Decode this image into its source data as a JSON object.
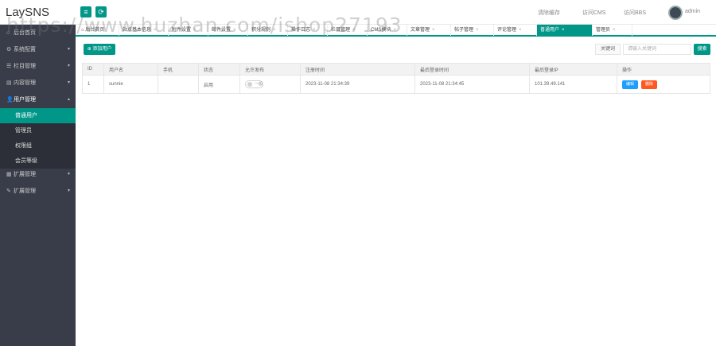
{
  "app": {
    "logo": "LaySNS"
  },
  "topbar": {
    "menu_icon": "≡",
    "refresh_icon": "⟳",
    "links": [
      "清除缓存",
      "访问CMS",
      "访问BBS"
    ],
    "user": "admin"
  },
  "sidebar": {
    "items": [
      {
        "icon": "⌂",
        "label": "后台首页"
      },
      {
        "icon": "⚙",
        "label": "系统配置",
        "arrow": "▾"
      },
      {
        "icon": "☰",
        "label": "栏目管理",
        "arrow": "▾"
      },
      {
        "icon": "▤",
        "label": "内容管理",
        "arrow": "▾"
      },
      {
        "icon": "👤",
        "label": "用户管理",
        "arrow": "▴"
      }
    ],
    "sub_items": [
      {
        "label": "普通用户",
        "active": true
      },
      {
        "label": "管理员"
      },
      {
        "label": "权限组"
      },
      {
        "label": "会员等级"
      }
    ],
    "bottom_items": [
      {
        "icon": "▦",
        "label": "扩展管理",
        "arrow": "▾"
      },
      {
        "icon": "✎",
        "label": "扩展管理",
        "arrow": "▾"
      }
    ]
  },
  "tabs": [
    {
      "label": "后台首页",
      "close": ""
    },
    {
      "label": "站点基本信息",
      "close": "×"
    },
    {
      "label": "附件设置",
      "close": "×"
    },
    {
      "label": "邮件设置",
      "close": "×"
    },
    {
      "label": "积分规则",
      "close": "×"
    },
    {
      "label": "操作日志",
      "close": "×"
    },
    {
      "label": "栏目管理",
      "close": "×"
    },
    {
      "label": "CMS模块",
      "close": "×"
    },
    {
      "label": "文章管理",
      "close": "×"
    },
    {
      "label": "帖子管理",
      "close": "×"
    },
    {
      "label": "评论管理",
      "close": "×"
    },
    {
      "label": "普通用户",
      "close": "×",
      "active": true
    },
    {
      "label": "管理员",
      "close": "×"
    }
  ],
  "toolbar": {
    "add_label": "⊕ 添加用户",
    "keyword_label": "关键词",
    "keyword_placeholder": "请输入关键词",
    "search_label": "搜索"
  },
  "table": {
    "columns": [
      "ID",
      "用户名",
      "手机",
      "状态",
      "允许发布",
      "注册时间",
      "最后登录时间",
      "最后登录IP",
      "操作"
    ],
    "rows": [
      {
        "id": "1",
        "username": "sunnie",
        "phone": "",
        "status": "启用",
        "allow_post": "一般",
        "reg_time": "2023-11-08 21:34:39",
        "last_login": "2023-11-08 21:34:45",
        "last_ip": "101.39.49.141",
        "edit": "编辑",
        "delete": "删除"
      }
    ]
  },
  "watermark": "https://www.huzhan.com/ishop27193",
  "colors": {
    "accent": "#009688",
    "sidebar_bg": "#393d49",
    "edit_btn": "#1e9fff",
    "delete_btn": "#ff5722"
  }
}
